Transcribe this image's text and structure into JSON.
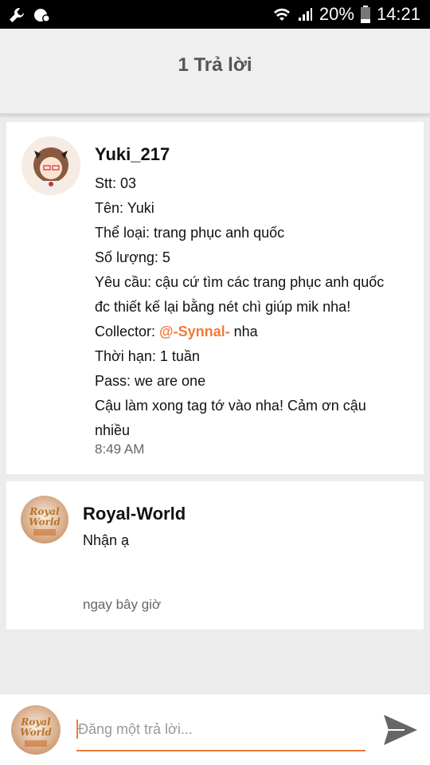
{
  "status_bar": {
    "battery": "20%",
    "time": "14:21",
    "icons": [
      "wrench-icon",
      "shield-icon",
      "wifi-icon",
      "signal-icon",
      "battery-icon"
    ]
  },
  "header": {
    "title": "1 Trả lời"
  },
  "post": {
    "author": "Yuki_217",
    "lines": {
      "l1": "Stt: 03",
      "l2": "Tên: Yuki",
      "l3": "Thể loại: trang phục anh quốc",
      "l4": "Số lượng: 5",
      "l5": "Yêu cầu: cậu cứ tìm các trang phục anh quốc",
      "l6": "đc thiết kế lại bằng nét chì giúp mik nha!",
      "l7_prefix": "Collector: ",
      "l7_mention": "@-Synnal-",
      "l7_suffix": " nha",
      "l8": "Thời hạn: 1 tuần",
      "l9": "Pass: we are one",
      "l10": "Cậu làm xong tag tớ vào nha! Cảm ơn cậu",
      "l11": "nhiều"
    },
    "time": "8:49 AM"
  },
  "reply": {
    "author": "Royal-World",
    "text": "Nhận ạ",
    "time": "ngay bây giờ",
    "avatar_text_1": "Royal",
    "avatar_text_2": "World"
  },
  "composer": {
    "placeholder": "Đăng một trả lời..."
  },
  "colors": {
    "accent": "#f07a3a",
    "background": "#ececec",
    "card": "#ffffff"
  }
}
